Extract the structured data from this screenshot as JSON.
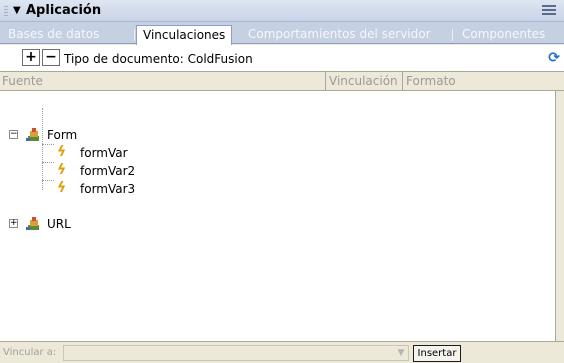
{
  "panel": {
    "title": "Aplicación",
    "collapse_icon": "triangle-down",
    "options_icon": "panel-options-menu"
  },
  "tabs": [
    {
      "label": "Bases de datos",
      "active": false
    },
    {
      "label": "Vinculaciones",
      "active": true
    },
    {
      "label": "Comportamientos del servidor",
      "active": false
    },
    {
      "label": "Componentes",
      "active": false
    }
  ],
  "toolbar": {
    "add_label": "+",
    "remove_label": "−",
    "document_type": "Tipo de documento: ColdFusion",
    "refresh_icon": "refresh"
  },
  "columns": [
    "Fuente",
    "Vinculación",
    "Formato"
  ],
  "tree": {
    "nodes": [
      {
        "label": "Form",
        "expanded": true,
        "toggle_symbol": "−",
        "icon": "form-icon",
        "children": [
          {
            "label": "formVar",
            "icon": "lightning-icon"
          },
          {
            "label": "formVar2",
            "icon": "lightning-icon"
          },
          {
            "label": "formVar3",
            "icon": "lightning-icon"
          }
        ]
      },
      {
        "label": "URL",
        "expanded": false,
        "toggle_symbol": "+",
        "icon": "url-icon",
        "children": []
      }
    ]
  },
  "bottom": {
    "bind_label": "Vincular a:",
    "bind_value": "",
    "insert_label": "Insertar"
  },
  "colors": {
    "titlebar": "#c9d3e6",
    "tabbar": "#c6d0e3",
    "panel_bg": "#ece9d8",
    "accent_refresh": "#1f6fd1",
    "bolt": "#e0a000"
  }
}
